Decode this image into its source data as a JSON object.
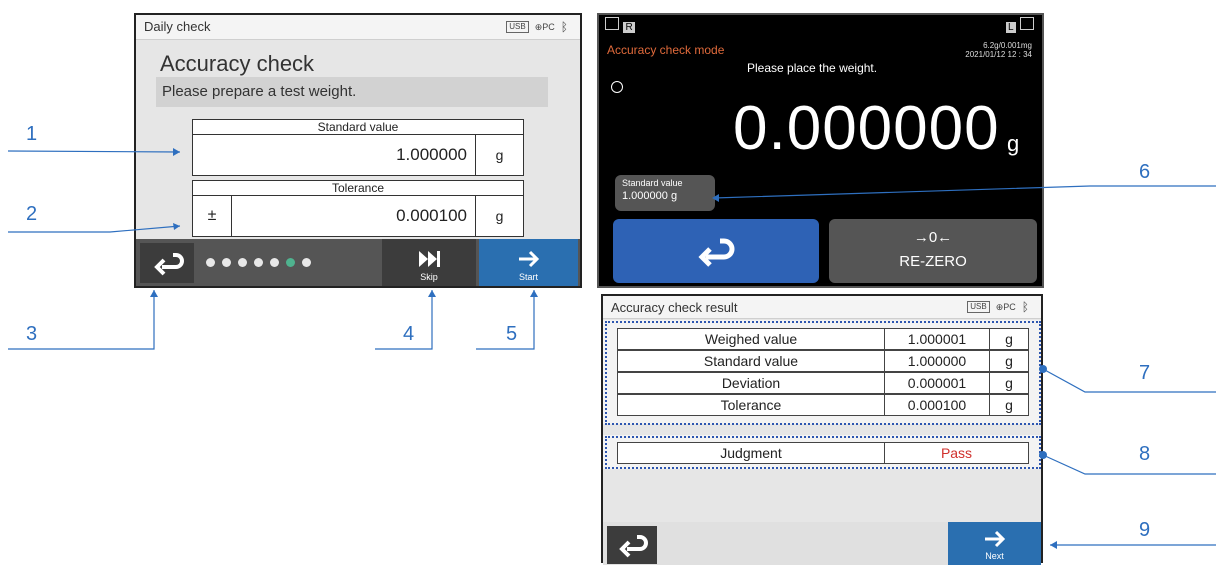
{
  "screen1": {
    "header_title": "Daily check",
    "status_icons": {
      "usb": "USB",
      "pc": "PC",
      "bluetooth": "bluetooth-icon"
    },
    "title": "Accuracy check",
    "prompt": "Please prepare a test weight.",
    "standard_value": {
      "label": "Standard value",
      "value": "1.000000",
      "unit": "g"
    },
    "tolerance": {
      "label": "Tolerance",
      "sign": "±",
      "value": "0.000100",
      "unit": "g"
    },
    "page_indicator": {
      "total": 7,
      "active_index": 5
    },
    "buttons": {
      "back_icon": "return-arrow-icon",
      "skip_label": "Skip",
      "skip_icon": "skip-forward-icon",
      "start_label": "Start",
      "start_icon": "right-arrow-icon"
    }
  },
  "screen2": {
    "indicator_left": "R",
    "indicator_right": "L",
    "mode": "Accuracy check mode",
    "message": "Please place the weight.",
    "capacity": "6.2g/0.001mg",
    "datetime": "2021/01/12   12 : 34",
    "reading": "0.000000",
    "unit": "g",
    "standard_value": {
      "label": "Standard value",
      "value": "1.000000",
      "unit": "g"
    },
    "buttons": {
      "back_icon": "return-arrow-icon",
      "rezero_symbol": "→0←",
      "rezero_label": "RE-ZERO"
    }
  },
  "screen3": {
    "header_title": "Accuracy check result",
    "status_icons": {
      "usb": "USB",
      "pc": "PC",
      "bluetooth": "bluetooth-icon"
    },
    "rows": [
      {
        "label": "Weighed value",
        "value": "1.000001",
        "unit": "g"
      },
      {
        "label": "Standard value",
        "value": "1.000000",
        "unit": "g"
      },
      {
        "label": "Deviation",
        "value": "0.000001",
        "unit": "g"
      },
      {
        "label": "Tolerance",
        "value": "0.000100",
        "unit": "g"
      }
    ],
    "judgment": {
      "label": "Judgment",
      "value": "Pass",
      "value_color": "#d0302c"
    },
    "buttons": {
      "back_icon": "return-arrow-icon",
      "next_label": "Next",
      "next_icon": "right-arrow-icon"
    }
  },
  "callouts": [
    "1",
    "2",
    "3",
    "4",
    "5",
    "6",
    "7",
    "8",
    "9"
  ],
  "colors": {
    "callout": "#2e6fbf",
    "button_blue": "#2a6fb0",
    "mode_orange": "#e06a3b",
    "pass_red": "#d0302c"
  }
}
